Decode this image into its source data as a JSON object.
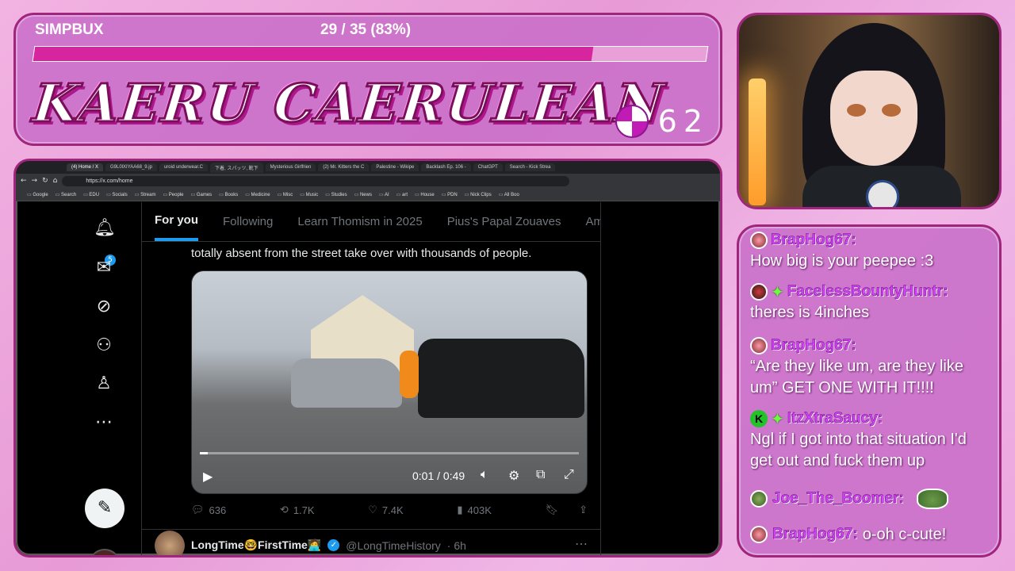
{
  "banner": {
    "simp_label": "SIMPBUX",
    "simp_count": "29 / 35 (83%)",
    "progress_percent": 83,
    "streamer_name": "KAERU CAERULEAN",
    "points": "62",
    "accent_color": "#d7249f"
  },
  "browser": {
    "tabs": [
      "(4) Home / X",
      "G9L0lXIYAA68_9.jp",
      "uroid underwear.C",
      "下着, スパッツ, 靴下",
      "Mysterious Girlfrien",
      "(2) Mr. Kitters the C",
      "Palestine - Wikipe",
      "Backlash Ep. 106 -",
      "ChatGPT",
      "Search - Kick Strea"
    ],
    "url": "https://x.com/home",
    "bookmarks": [
      "Google",
      "Search",
      "EDU",
      "Socials",
      "Stream",
      "People",
      "Games",
      "Books",
      "Medicine",
      "Misc",
      "Music",
      "Studies",
      "News",
      "AI",
      "art",
      "House",
      "PDN",
      "Nick Clips",
      "All Boo"
    ]
  },
  "x": {
    "notif_count": "5",
    "tabs": [
      "For you",
      "Following",
      "Learn Thomism in 2025",
      "Pius's Papal Zouaves",
      "Am"
    ],
    "tweet_text": "totally absent from the street take over with thousands of people.",
    "video_time": "0:01 / 0:49",
    "video_progress_percent": 2,
    "replies": "636",
    "reposts": "1.7K",
    "likes": "7.4K",
    "views": "403K",
    "next_name": "LongTime🤓FirstTime🧑‍💻",
    "next_handle": "@LongTimeHistory",
    "next_time": "· 6h"
  },
  "chat": [
    {
      "user": "BrapHog67:",
      "text": "How big is your peepee :3",
      "color": "#d743ff"
    },
    {
      "user": "FacelessBountyHuntr:",
      "text": "theres is 4inches",
      "color": "#d743ff"
    },
    {
      "user": "BrapHog67:",
      "text": "“Are they like um, are they like um” GET ONE WITH IT!!!!",
      "color": "#d743ff"
    },
    {
      "user": "ItzXtraSaucy:",
      "text": "Ngl if I got into that situation I'd get out and fuck them up",
      "color": "#d743ff"
    },
    {
      "user": "Joe_The_Boomer:",
      "text": "",
      "color": "#d743ff"
    },
    {
      "user": "BrapHog67:",
      "text": "o-oh c-cute!",
      "color": "#d743ff"
    }
  ]
}
